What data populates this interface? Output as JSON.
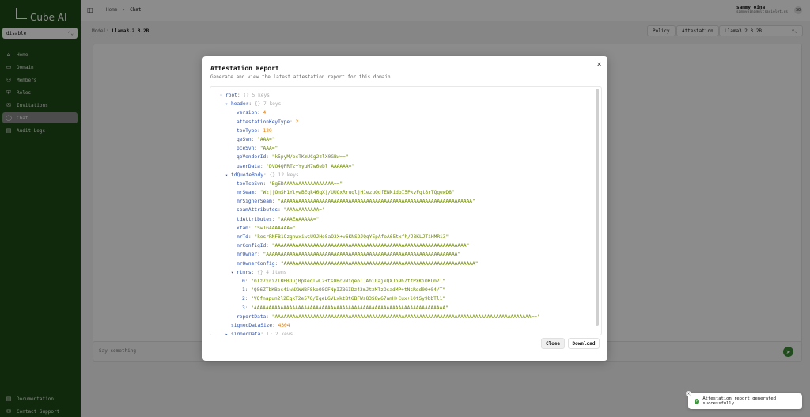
{
  "app": {
    "name": "Cube AI"
  },
  "sidebar": {
    "domain_select": "disable",
    "items": [
      {
        "label": "Home",
        "icon": "home-icon",
        "glyph": "⌂"
      },
      {
        "label": "Domain",
        "icon": "domain-icon",
        "glyph": "▭"
      },
      {
        "label": "Members",
        "icon": "members-icon",
        "glyph": "⚇"
      },
      {
        "label": "Roles",
        "icon": "roles-icon",
        "glyph": "⛨"
      },
      {
        "label": "Invitations",
        "icon": "invitations-icon",
        "glyph": "✉"
      },
      {
        "label": "Chat",
        "icon": "chat-icon",
        "glyph": "◯",
        "active": true
      },
      {
        "label": "Audit Logs",
        "icon": "audit-logs-icon",
        "glyph": "▤"
      }
    ],
    "bottom_items": [
      {
        "label": "Documentation",
        "icon": "documentation-icon",
        "glyph": "▤"
      },
      {
        "label": "Contact Support",
        "icon": "support-icon",
        "glyph": "✉"
      }
    ]
  },
  "topbar": {
    "breadcrumb": [
      "Home",
      "Chat"
    ],
    "user_name": "sammy oina",
    "user_email": "sammyoina@ultraviolet.rs",
    "avatar_initials": "SO"
  },
  "model_bar": {
    "label": "Model:",
    "value": "Llama3.2 3.2B",
    "policy_label": "Policy",
    "attestation_label": "Attestation",
    "select_value": "Llama3.2 3.2B"
  },
  "chat": {
    "input_placeholder": "Say something"
  },
  "modal": {
    "title": "Attestation Report",
    "subtitle": "Generate and view the latest attestation report for this domain.",
    "close_label": "Close",
    "download_label": "Download",
    "json_lines": [
      {
        "indent": 0,
        "toggle": "▾",
        "key": "root",
        "count": "5 keys"
      },
      {
        "indent": 1,
        "toggle": "▾",
        "key": "header",
        "count": "7 keys"
      },
      {
        "indent": 2,
        "key": "version",
        "num": "4"
      },
      {
        "indent": 2,
        "key": "attestationKeyType",
        "num": "2"
      },
      {
        "indent": 2,
        "key": "teeType",
        "num": "129"
      },
      {
        "indent": 2,
        "key": "qeSvn",
        "str": "\"AAA=\""
      },
      {
        "indent": 2,
        "key": "pceSvn",
        "str": "\"AAA=\""
      },
      {
        "indent": 2,
        "key": "qeVendorId",
        "str": "\"k5pyM/ecTKmUCg2zlX0GBw==\""
      },
      {
        "indent": 2,
        "key": "userData",
        "str": "\"DVO4QPRTz+YyuM7w6ebl AAAAAA=\""
      },
      {
        "indent": 1,
        "toggle": "▾",
        "key": "tdQuoteBody",
        "count": "12 keys"
      },
      {
        "indent": 2,
        "key": "teeTcbSvn",
        "str": "\"BgEDAAAAAAAAAAAAAAAAA==\""
      },
      {
        "indent": 2,
        "key": "mrSeam",
        "str": "\"WzjjOmSH1YtywBEqk46qXj/UUQxRruqljH1ezuQdfENkidbI5PkvFgt8rTQgewD8\""
      },
      {
        "indent": 2,
        "key": "mrSignerSeam",
        "str": "\"AAAAAAAAAAAAAAAAAAAAAAAAAAAAAAAAAAAAAAAAAAAAAAAAAAAAAAAAAAAAAAAAA\""
      },
      {
        "indent": 2,
        "key": "seamAttributes",
        "str": "\"AAAAAAAAAAA=\""
      },
      {
        "indent": 2,
        "key": "tdAttributes",
        "str": "\"AAAAEAAAAAA=\""
      },
      {
        "indent": 2,
        "key": "xfam",
        "str": "\"5wIGAAAAAAA=\""
      },
      {
        "indent": 2,
        "key": "mrTd",
        "str": "\"kesrRNFB1OzgnwxiwsU9JHo8aO3X+v6KNSDJQqYEpAfeA65txfh/J8KLJTiHMRi3\""
      },
      {
        "indent": 2,
        "key": "mrConfigId",
        "str": "\"AAAAAAAAAAAAAAAAAAAAAAAAAAAAAAAAAAAAAAAAAAAAAAAAAAAAAAAAAAAAAAAAA\""
      },
      {
        "indent": 2,
        "key": "mrOwner",
        "str": "\"AAAAAAAAAAAAAAAAAAAAAAAAAAAAAAAAAAAAAAAAAAAAAAAAAAAAAAAAAAAAAAAAA\""
      },
      {
        "indent": 2,
        "key": "mrOwnerConfig",
        "str": "\"AAAAAAAAAAAAAAAAAAAAAAAAAAAAAAAAAAAAAAAAAAAAAAAAAAAAAAAAAAAAAAAAA\""
      },
      {
        "indent": 2,
        "toggle": "▾",
        "key": "rtmrs",
        "count": "4 items"
      },
      {
        "indent": 3,
        "key": "0",
        "str": "\"mIz7xri7lBFBOujBpKedlwL2+ts0BcvNiqeolJAhiGajkQXJo9h7ffPXKiOKLm7l\""
      },
      {
        "indent": 3,
        "key": "1",
        "str": "\"Q86ZTbKBbs4iwNXWWBFSkoO8OFNpIZBGIDz43mJtzMTzOsadMP+tNsRod0O+04/T\""
      },
      {
        "indent": 3,
        "key": "2",
        "str": "\"VQfnapun2l2EqkT2e57O/IqeLGVLxktBtGBFWs83S8w67amH+Cux+l0tSy9bbTl1\""
      },
      {
        "indent": 3,
        "key": "3",
        "str": "\"AAAAAAAAAAAAAAAAAAAAAAAAAAAAAAAAAAAAAAAAAAAAAAAAAAAAAAAAAAAAAAAAA\""
      },
      {
        "indent": 2,
        "key": "reportData",
        "str": "\"AAAAAAAAAAAAAAAAAAAAAAAAAAAAAAAAAAAAAAAAAAAAAAAAAAAAAAAAAAAAAAAAAAAAAAAAAAAAAAAAAAAAAAA==\""
      },
      {
        "indent": 1,
        "key": "signedDataSize",
        "num": "4304"
      },
      {
        "indent": 1,
        "toggle": "▸",
        "key": "signedData",
        "count": "2 keys"
      }
    ]
  },
  "toast": {
    "message": "Attestation report generated successfully."
  },
  "colors": {
    "sidebar": "#1e4a16",
    "accent": "#3c8a35",
    "json_key": "#2b4fa8",
    "json_number": "#e07b00",
    "json_string": "#6d8a00"
  }
}
